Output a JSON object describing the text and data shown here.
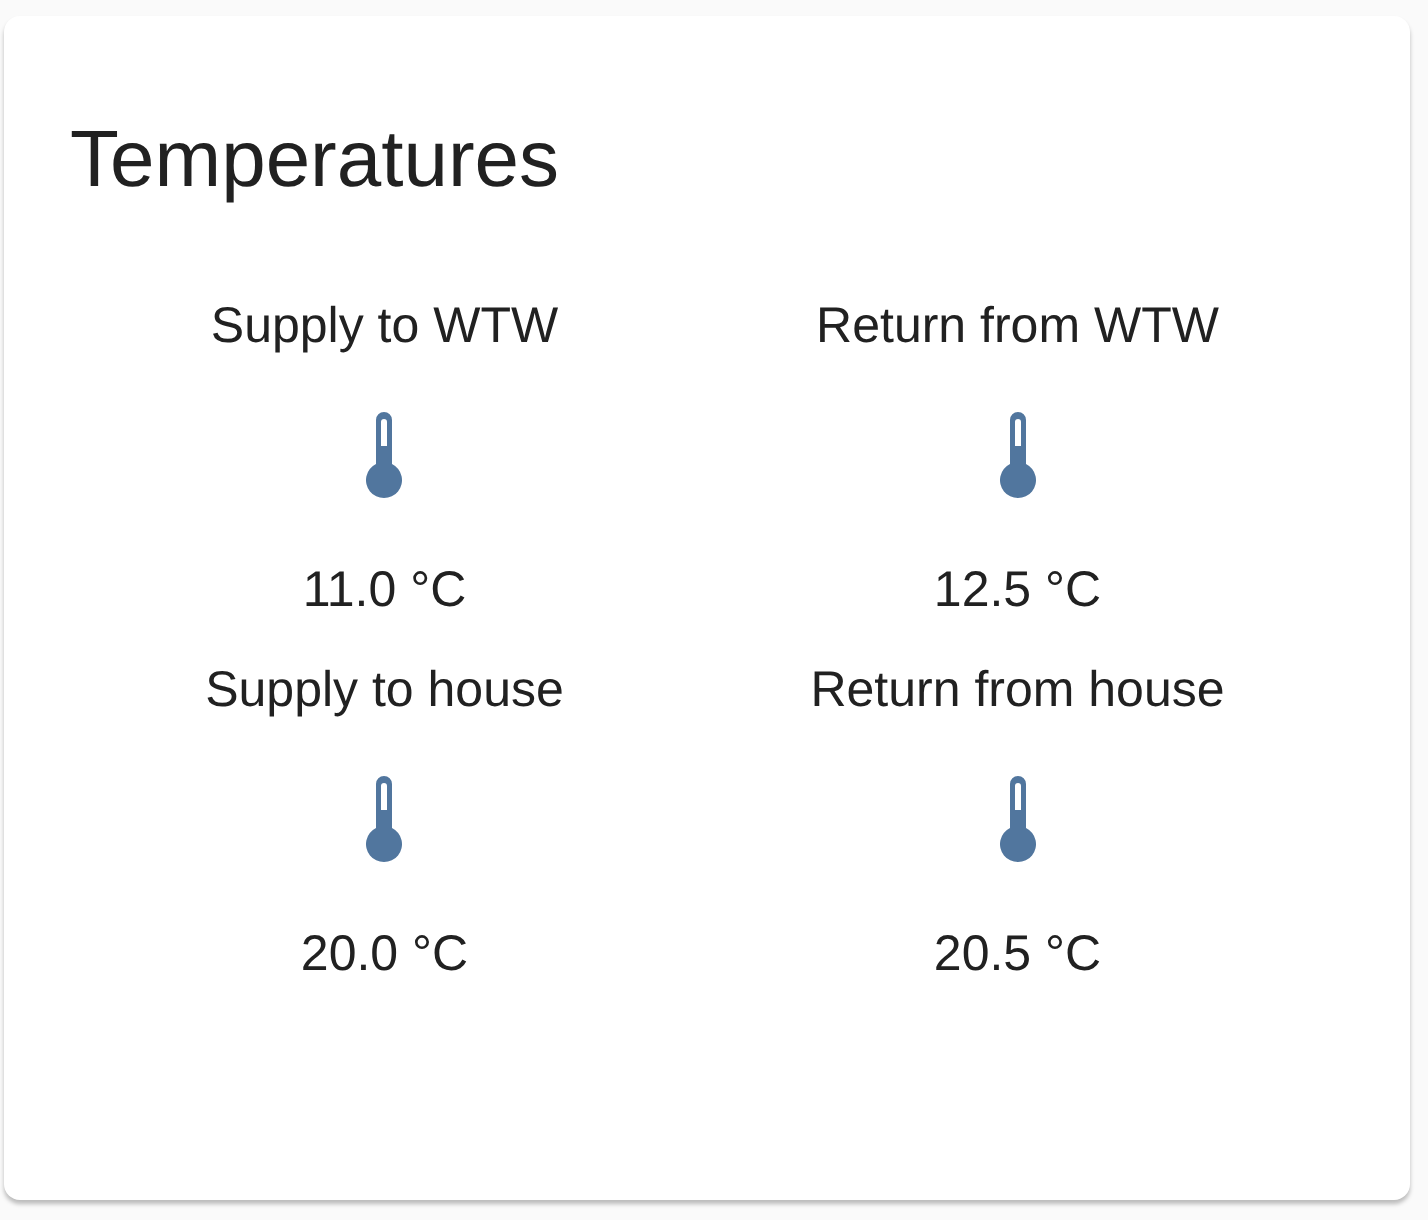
{
  "card": {
    "title": "Temperatures",
    "entities": [
      {
        "name": "Supply to WTW",
        "state": "11.0 °C"
      },
      {
        "name": "Return from WTW",
        "state": "12.5 °C"
      },
      {
        "name": "Supply to house",
        "state": "20.0 °C"
      },
      {
        "name": "Return from house",
        "state": "20.5 °C"
      }
    ]
  }
}
